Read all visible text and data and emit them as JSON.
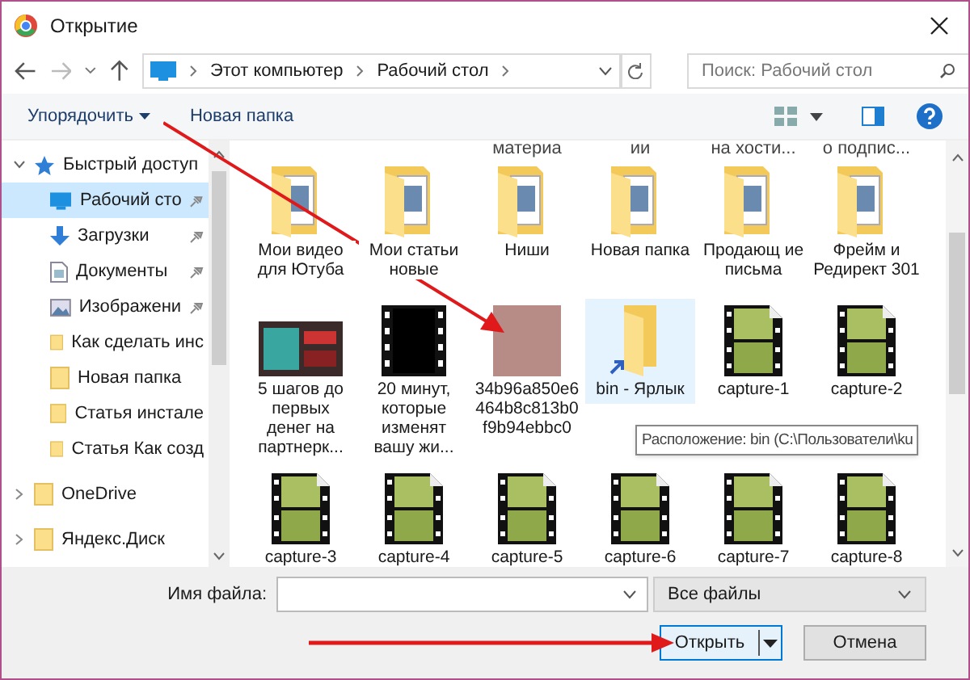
{
  "window": {
    "title": "Открытие"
  },
  "address_bar": {
    "path": [
      "Этот компьютер",
      "Рабочий стол"
    ]
  },
  "search": {
    "placeholder": "Поиск: Рабочий стол"
  },
  "toolbar": {
    "organize": "Упорядочить",
    "new_folder": "Новая папка"
  },
  "sidebar": {
    "items": [
      {
        "label": "Быстрый доступ",
        "kind": "star",
        "expanded": true,
        "children": [
          {
            "label": "Рабочий сто",
            "kind": "desktop",
            "pinned": true,
            "selected": true
          },
          {
            "label": "Загрузки",
            "kind": "download",
            "pinned": true,
            "selected": false
          },
          {
            "label": "Документы",
            "kind": "document",
            "pinned": true,
            "selected": false
          },
          {
            "label": "Изображени",
            "kind": "picture",
            "pinned": true,
            "selected": false
          },
          {
            "label": "Как сделать инс",
            "kind": "folder",
            "pinned": false,
            "selected": false
          },
          {
            "label": "Новая папка",
            "kind": "folder",
            "pinned": false,
            "selected": false
          },
          {
            "label": "Статья инстале",
            "kind": "folder",
            "pinned": false,
            "selected": false
          },
          {
            "label": "Статья Как созд",
            "kind": "folder",
            "pinned": false,
            "selected": false
          }
        ]
      },
      {
        "label": "OneDrive",
        "kind": "folder",
        "expanded": false
      },
      {
        "label": "Яндекс.Диск",
        "kind": "folder",
        "expanded": false
      }
    ]
  },
  "partial_labels": [
    "материа",
    "ии",
    "на хости...",
    "о подпис..."
  ],
  "files": [
    {
      "name": "Мои видео для Ютуба",
      "kind": "folder",
      "selected": false
    },
    {
      "name": "Мои статьи новые",
      "kind": "folder",
      "selected": false
    },
    {
      "name": "Ниши",
      "kind": "folder",
      "selected": false
    },
    {
      "name": "Новая папка",
      "kind": "folder",
      "selected": false
    },
    {
      "name": "Продающ ие письма",
      "kind": "folder",
      "selected": false
    },
    {
      "name": "Фрейм и Редирект 301",
      "kind": "folder",
      "selected": false
    },
    {
      "name": "5 шагов до первых денег на партнерк...",
      "kind": "image",
      "selected": false
    },
    {
      "name": "20 минут, которые изменят вашу жи...",
      "kind": "video",
      "selected": false
    },
    {
      "name": "34b96a850e6464b8c813b0f9b94ebbc0",
      "kind": "photo",
      "selected": false
    },
    {
      "name": "bin - Ярлык",
      "kind": "shortcut",
      "selected": true
    },
    {
      "name": "capture-1",
      "kind": "film",
      "selected": false
    },
    {
      "name": "capture-2",
      "kind": "film",
      "selected": false
    },
    {
      "name": "capture-3",
      "kind": "film",
      "selected": false
    },
    {
      "name": "capture-4",
      "kind": "film",
      "selected": false
    },
    {
      "name": "capture-5",
      "kind": "film",
      "selected": false
    },
    {
      "name": "capture-6",
      "kind": "film",
      "selected": false
    },
    {
      "name": "capture-7",
      "kind": "film",
      "selected": false
    },
    {
      "name": "capture-8",
      "kind": "film",
      "selected": false
    }
  ],
  "tooltip": "Расположение: bin (C:\\Пользователи\\ku",
  "filename": {
    "label": "Имя файла:"
  },
  "filter": "Все файлы",
  "buttons": {
    "open": "Открыть",
    "cancel": "Отмена"
  }
}
